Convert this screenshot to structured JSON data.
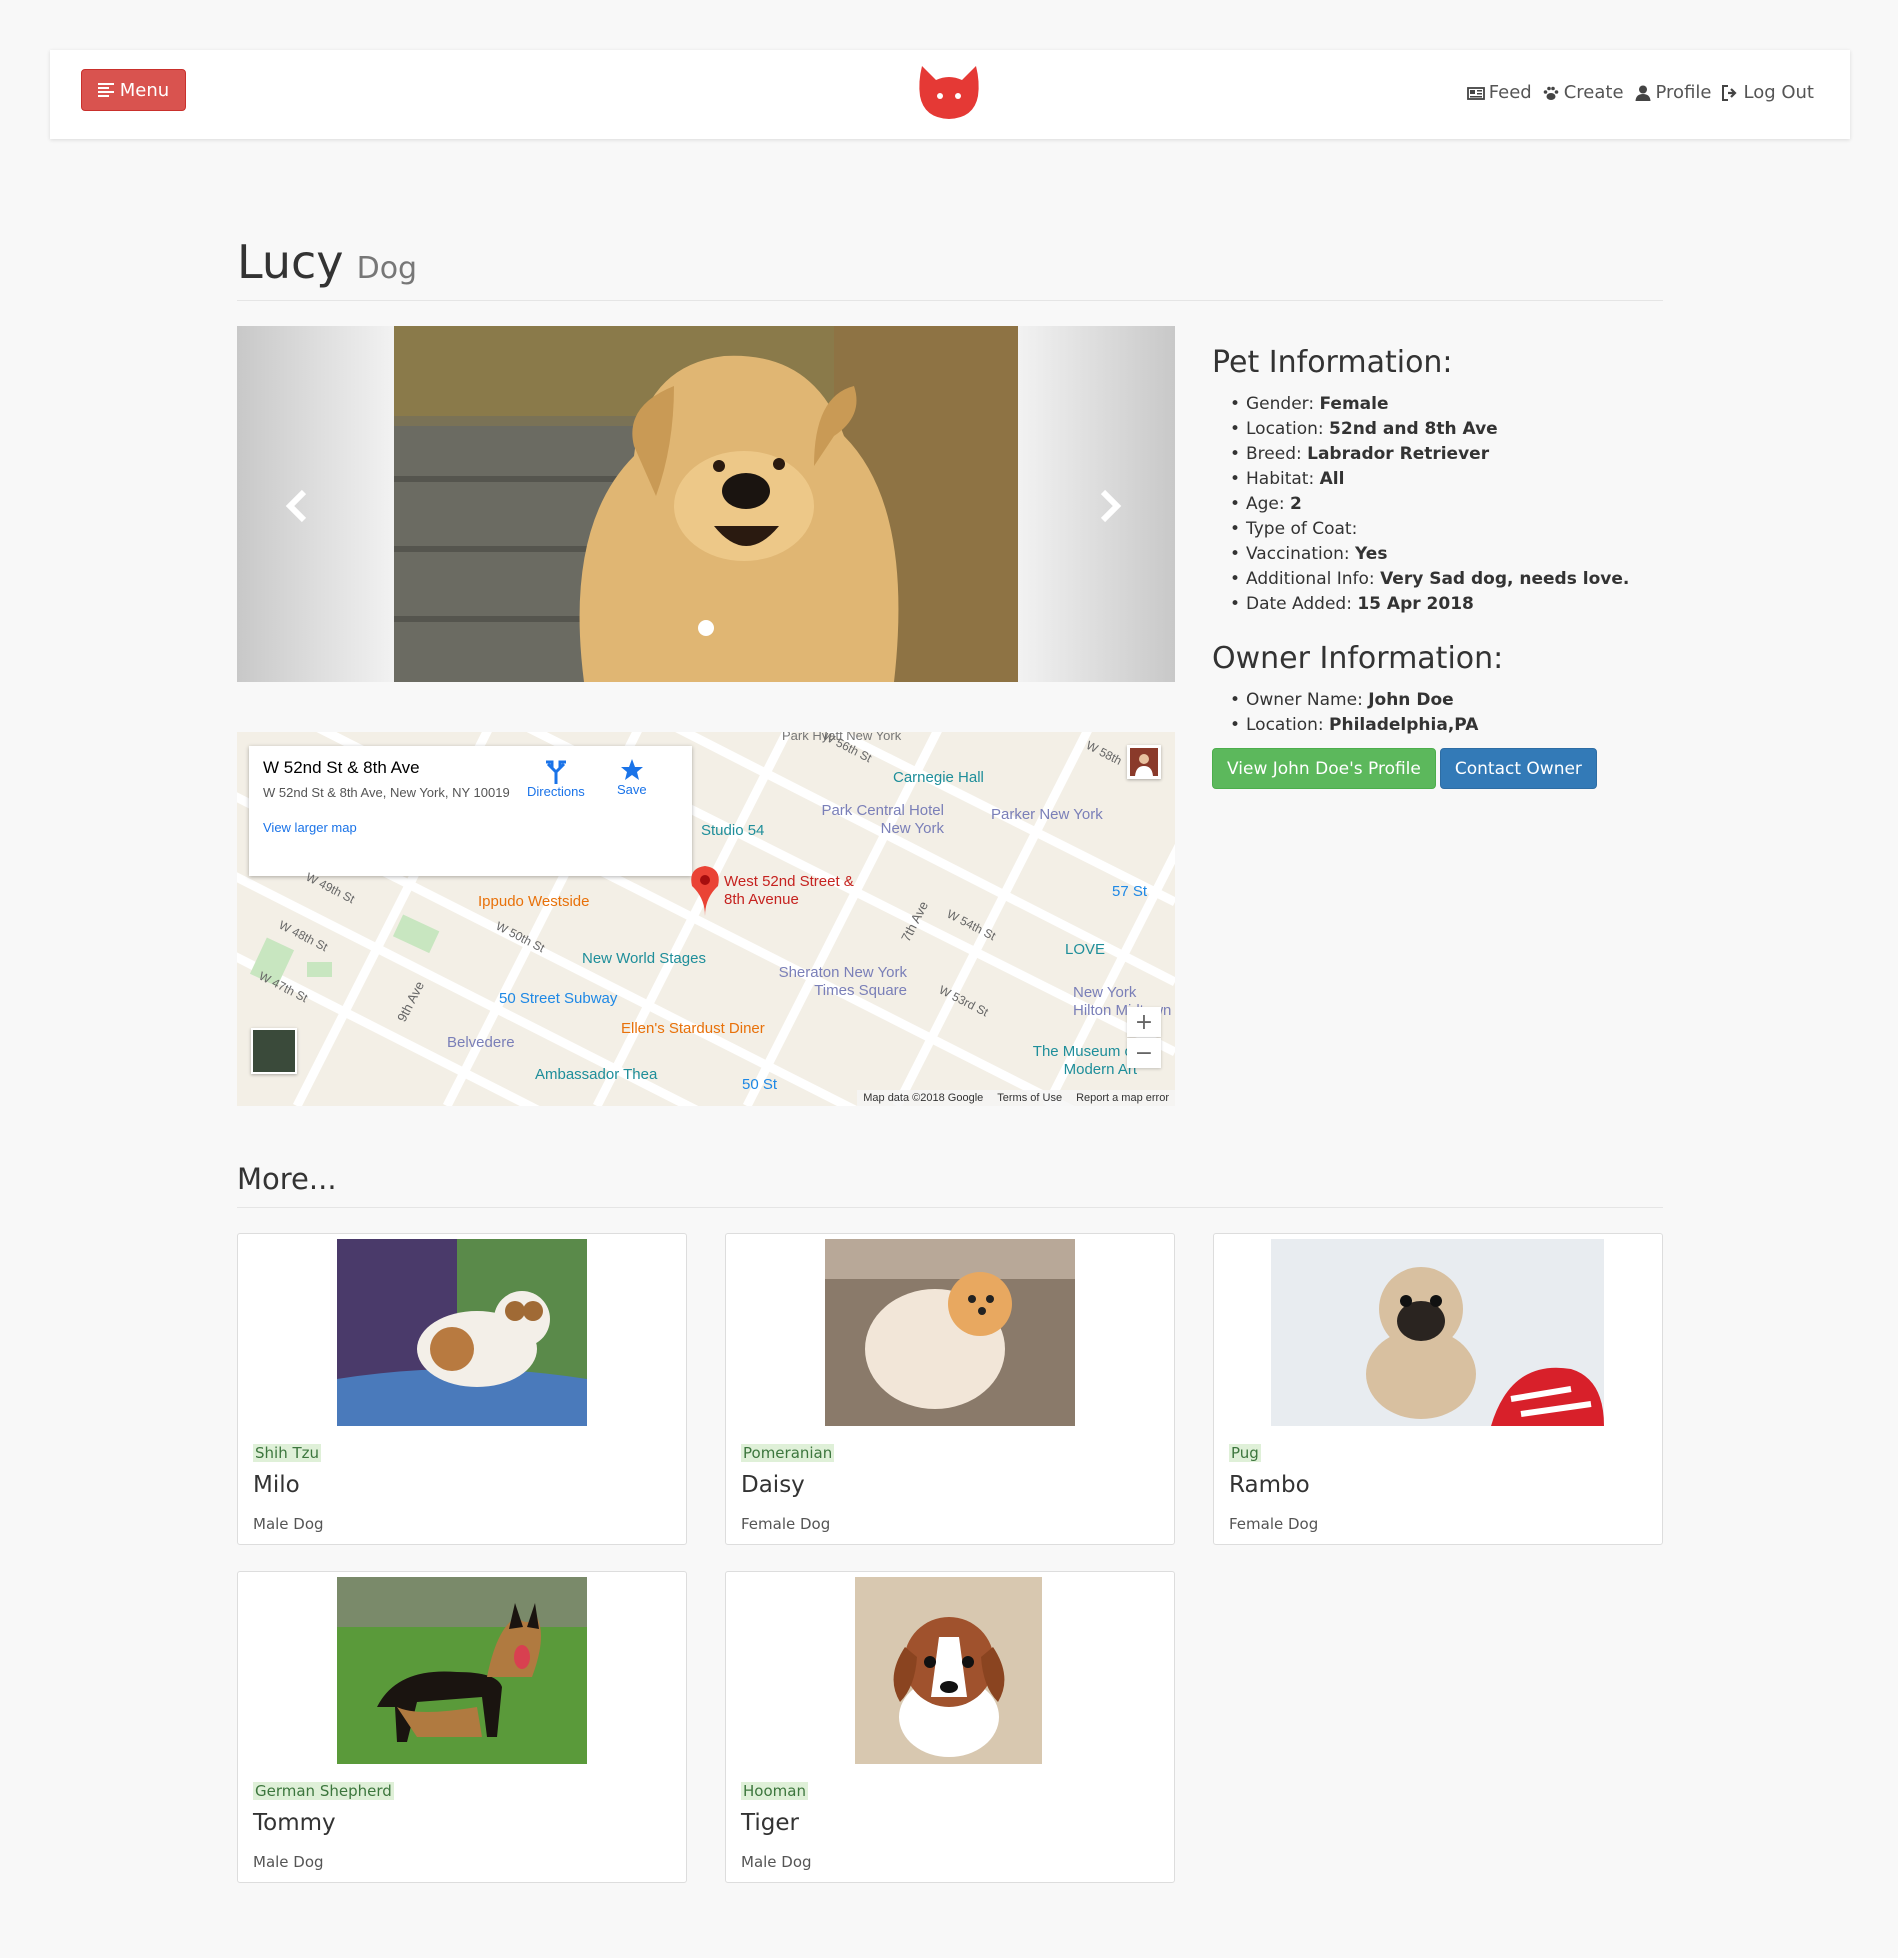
{
  "nav": {
    "menu_label": "Menu",
    "links": [
      {
        "label": "Feed",
        "icon": "newspaper-icon"
      },
      {
        "label": "Create",
        "icon": "paw-icon"
      },
      {
        "label": "Profile",
        "icon": "user-icon"
      },
      {
        "label": "Log Out",
        "icon": "logout-icon"
      }
    ],
    "brand_color": "#e53935"
  },
  "pet": {
    "name": "Lucy",
    "type": "Dog"
  },
  "pet_info": {
    "heading": "Pet Information:",
    "items": [
      {
        "label": "Gender:",
        "value": "Female"
      },
      {
        "label": "Location:",
        "value": "52nd and 8th Ave"
      },
      {
        "label": "Breed:",
        "value": "Labrador Retriever"
      },
      {
        "label": "Habitat:",
        "value": "All"
      },
      {
        "label": "Age:",
        "value": "2"
      },
      {
        "label": "Type of Coat:",
        "value": ""
      },
      {
        "label": "Vaccination:",
        "value": "Yes"
      },
      {
        "label": "Additional Info:",
        "value": "Very Sad dog, needs love."
      },
      {
        "label": "Date Added:",
        "value": "15 Apr 2018"
      }
    ]
  },
  "owner_info": {
    "heading": "Owner Information:",
    "items": [
      {
        "label": "Owner Name:",
        "value": "John Doe"
      },
      {
        "label": "Location:",
        "value": "Philadelphia,PA"
      }
    ],
    "view_profile_label": "View John Doe's Profile",
    "contact_label": "Contact Owner"
  },
  "map": {
    "place_title": "W 52nd St & 8th Ave",
    "place_address": "W 52nd St & 8th Ave, New York, NY 10019",
    "view_larger": "View larger map",
    "directions_label": "Directions",
    "save_label": "Save",
    "labels": {
      "carnegie": "Carnegie Hall",
      "park_central": "Park Central Hotel New York",
      "parker": "Parker New York",
      "studio54": "Studio 54",
      "pin": "West 52nd Street & 8th Avenue",
      "ippudo": "Ippudo Westside",
      "st57": "57 St",
      "nws": "New World Stages",
      "love": "LOVE",
      "sheraton": "Sheraton New York Times Square",
      "st50sub": "50 Street Subway",
      "nyhilton": "New York Hilton Midtown",
      "ellens": "Ellen's Stardust Diner",
      "belvedere": "Belvedere",
      "moma": "The Museum of Modern Art",
      "ambassador": "Ambassador Thea",
      "st50": "50 St",
      "w49": "W 49th St",
      "w48": "W 48th St",
      "w47": "W 47th St",
      "w50": "W 50th St",
      "w54": "W 54th St",
      "w53": "W 53rd St",
      "w56": "W 56th St",
      "w58": "W 58th",
      "ave7": "7th Ave",
      "ave9": "9th Ave",
      "parkhyatt": "Park Hyatt New York"
    },
    "footer": {
      "data": "Map data ©2018 Google",
      "terms": "Terms of Use",
      "report": "Report a map error"
    }
  },
  "more": {
    "heading": "More...",
    "cards": [
      {
        "breed": "Shih Tzu",
        "name": "Milo",
        "sub": "Male Dog"
      },
      {
        "breed": "Pomeranian",
        "name": "Daisy",
        "sub": "Female Dog"
      },
      {
        "breed": "Pug",
        "name": "Rambo",
        "sub": "Female Dog"
      },
      {
        "breed": "German Shepherd",
        "name": "Tommy",
        "sub": "Male Dog"
      },
      {
        "breed": "Hooman",
        "name": "Tiger",
        "sub": "Male Dog"
      }
    ]
  }
}
